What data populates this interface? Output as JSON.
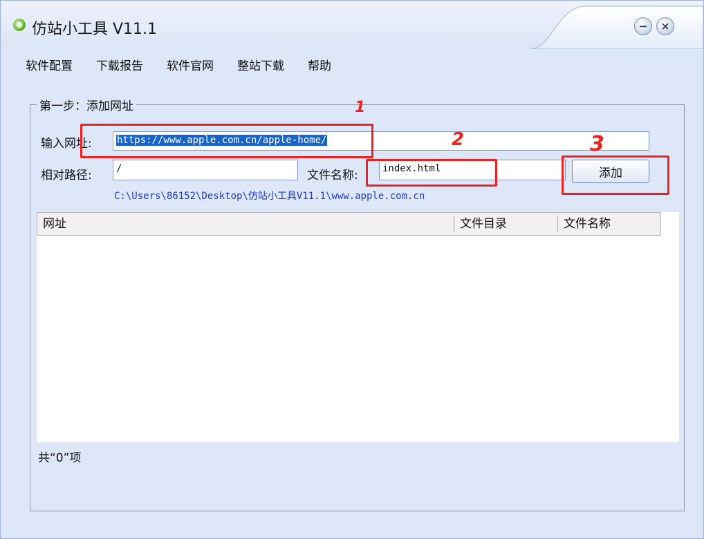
{
  "window": {
    "title": "仿站小工具 V11.1",
    "minimize_label": "−",
    "close_label": "×"
  },
  "menu": {
    "items": [
      "软件配置",
      "下载报告",
      "软件官网",
      "整站下载",
      "帮助"
    ]
  },
  "step": {
    "title": "第一步：添加网址",
    "url_label": "输入网址:",
    "url_value": "https://www.apple.com.cn/apple-home/",
    "rel_path_label": "相对路径:",
    "rel_path_value": "/",
    "filename_label": "文件名称:",
    "filename_value": "index.html",
    "add_button": "添加",
    "save_path": "C:\\Users\\86152\\Desktop\\仿站小工具V11.1\\www.apple.com.cn"
  },
  "list": {
    "columns": [
      "网址",
      "文件目录",
      "文件名称"
    ],
    "rows": [],
    "count_text": "共“0”项"
  },
  "annotations": {
    "labels": [
      "1",
      "2",
      "3"
    ],
    "color": "#f02020"
  },
  "colors": {
    "window_bg": "#dde7f7",
    "selection": "#1865c9",
    "path_text": "#1a3bd6"
  }
}
